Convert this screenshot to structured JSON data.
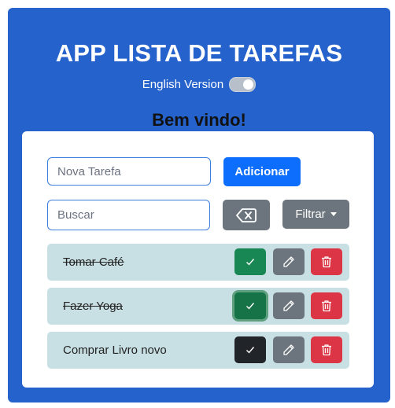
{
  "header": {
    "title": "APP LISTA DE TAREFAS",
    "language_toggle_label": "English Version",
    "welcome": "Bem vindo!"
  },
  "form": {
    "new_task_placeholder": "Nova Tarefa",
    "add_button_label": "Adicionar",
    "search_placeholder": "Buscar",
    "filter_button_label": "Filtrar"
  },
  "tasks": [
    {
      "label": "Tomar Café",
      "done": true
    },
    {
      "label": "Fazer Yoga",
      "done": true
    },
    {
      "label": "Comprar Livro novo",
      "done": false
    }
  ],
  "icons": {
    "clear": "backspace-icon",
    "check": "check-icon",
    "edit": "pencil-icon",
    "delete": "trash-icon"
  },
  "colors": {
    "header_bg": "#2562cc",
    "primary": "#0d6efd",
    "success": "#198754",
    "secondary": "#6c757d",
    "danger": "#dc3545",
    "task_bg": "#c8e0e4"
  }
}
